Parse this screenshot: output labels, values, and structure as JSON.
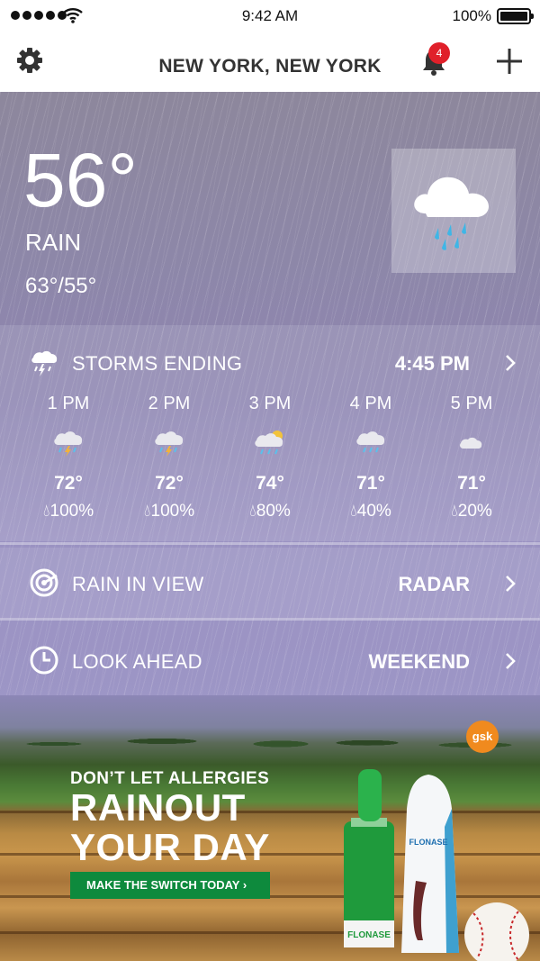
{
  "status_bar": {
    "time": "9:42 AM",
    "battery": "100%"
  },
  "header": {
    "location": "NEW YORK, NEW YORK",
    "notification_count": "4"
  },
  "current": {
    "temperature": "56°",
    "condition": "RAIN",
    "hi_lo": "63°/55°"
  },
  "storms": {
    "label": "STORMS ENDING",
    "time": "4:45 PM"
  },
  "hourly": [
    {
      "hour": "1 PM",
      "temp": "72°",
      "precip": "100%",
      "icon": "thunderstorm-icon"
    },
    {
      "hour": "2 PM",
      "temp": "72°",
      "precip": "100%",
      "icon": "thunderstorm-icon"
    },
    {
      "hour": "3 PM",
      "temp": "74°",
      "precip": "80%",
      "icon": "sun-showers-icon"
    },
    {
      "hour": "4 PM",
      "temp": "71°",
      "precip": "40%",
      "icon": "rain-icon"
    },
    {
      "hour": "5 PM",
      "temp": "71°",
      "precip": "20%",
      "icon": "cloud-icon"
    }
  ],
  "radar_row": {
    "label": "RAIN IN VIEW",
    "value": "RADAR"
  },
  "lookahead_row": {
    "label": "LOOK AHEAD",
    "value": "WEEKEND"
  },
  "ad": {
    "line1": "DON’T LET ALLERGIES",
    "line2": "RAINOUT",
    "line3": "YOUR DAY",
    "cta": "MAKE THE SWITCH TODAY ›",
    "brand_logo": "gsk",
    "product_name": "FLONASE"
  }
}
